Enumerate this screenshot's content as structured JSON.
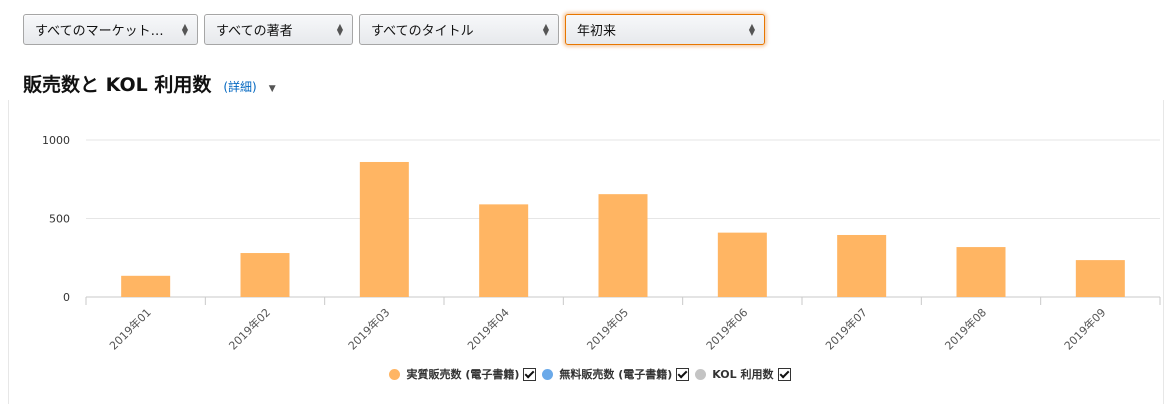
{
  "filters": [
    {
      "value": "すべてのマーケット…",
      "active": false
    },
    {
      "value": "すべての著者",
      "active": false
    },
    {
      "value": "すべてのタイトル",
      "active": false
    },
    {
      "value": "年初来",
      "active": true
    }
  ],
  "header": {
    "title": "販売数と KOL 利用数",
    "detail_link": "(詳細)"
  },
  "chart_data": {
    "type": "bar",
    "categories": [
      "2019年01",
      "2019年02",
      "2019年03",
      "2019年04",
      "2019年05",
      "2019年06",
      "2019年07",
      "2019年08",
      "2019年09"
    ],
    "series": [
      {
        "name": "実質販売数 (電子書籍)",
        "color": "#ffb563",
        "values": [
          135,
          280,
          860,
          590,
          655,
          410,
          395,
          318,
          235
        ]
      },
      {
        "name": "無料販売数 (電子書籍)",
        "color": "#6aa9e9",
        "values": [
          0,
          0,
          0,
          0,
          0,
          0,
          0,
          0,
          0
        ]
      },
      {
        "name": "KOL 利用数",
        "color": "#c4c4c4",
        "values": [
          0,
          0,
          0,
          0,
          0,
          0,
          0,
          0,
          0
        ]
      }
    ],
    "yticks": [
      "0",
      "500",
      "1000"
    ],
    "ylim": [
      0,
      1000
    ],
    "grid": true,
    "legend_position": "bottom-center"
  },
  "colors": {
    "bar": "#ffb563",
    "accent": "#e77600",
    "link": "#0066c0"
  }
}
